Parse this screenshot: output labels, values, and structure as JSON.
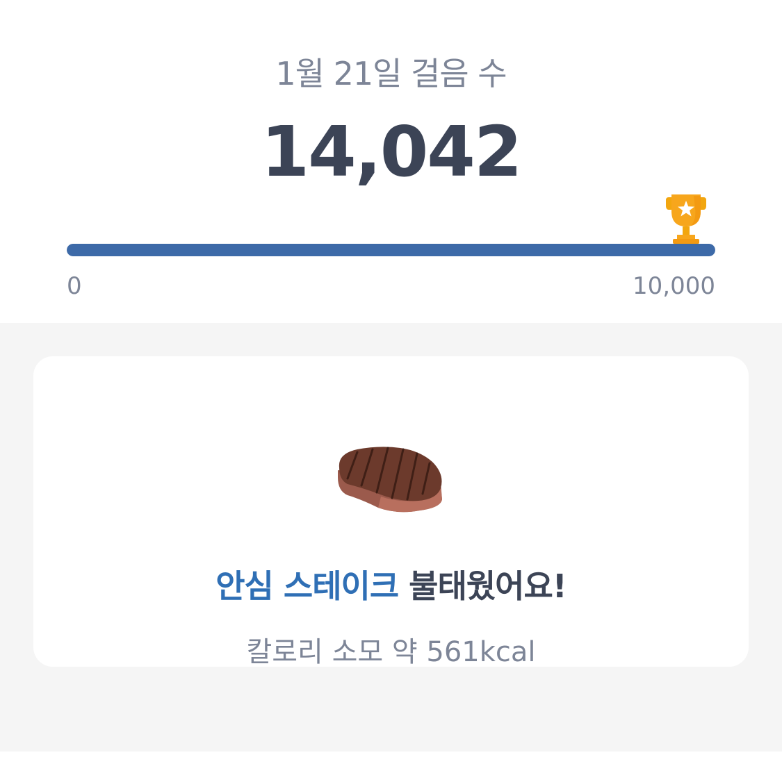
{
  "summary": {
    "date_label": "1월 21일 걸음 수",
    "step_count": "14,042",
    "progress": {
      "current_steps": 14042,
      "goal_steps": 10000,
      "fill_fraction": 1.0,
      "min_label": "0",
      "max_label": "10,000",
      "fill_color": "#3d6aa8",
      "goal_icon": "trophy-icon"
    }
  },
  "burn_card": {
    "food_icon": "steak-icon",
    "food_name": "안심 스테이크",
    "burn_text": " 불태웠어요!",
    "calorie_text": "칼로리 소모 약 561kcal",
    "accent_color": "#2f6fb5"
  }
}
